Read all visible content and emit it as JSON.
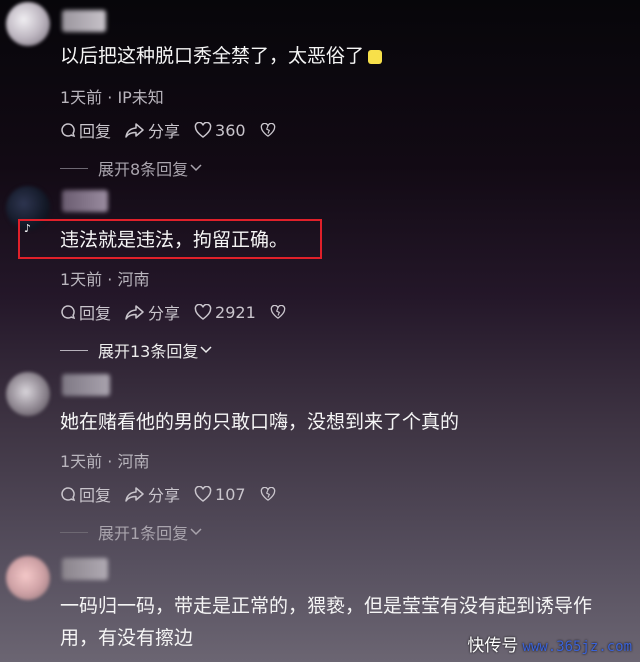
{
  "comments": [
    {
      "text": "以后把这种脱口秀全禁了，太恶俗了",
      "meta": "1天前 · IP未知",
      "reply_label": "回复",
      "share_label": "分享",
      "likes": "360",
      "expand_label": "展开8条回复"
    },
    {
      "text": "违法就是违法，拘留正确。",
      "meta": "1天前 · 河南",
      "reply_label": "回复",
      "share_label": "分享",
      "likes": "2921",
      "expand_label": "展开13条回复"
    },
    {
      "text": "她在赌看他的男的只敢口嗨，没想到来了个真的",
      "meta": "1天前 · 河南",
      "reply_label": "回复",
      "share_label": "分享",
      "likes": "107",
      "expand_label": "展开1条回复"
    },
    {
      "text_line1": "一码归一码，带走是正常的，猥亵，但是莹莹有没有起到诱导作",
      "text_line2": "用，有没有擦边"
    }
  ],
  "watermark": {
    "prefix": "快传号",
    "url": "www.365jz.com"
  },
  "colors": {
    "highlight_border": "#e0202a",
    "text": "#f5f5f5",
    "meta": "#b9b5bd"
  },
  "icons": [
    "comment-icon",
    "share-icon",
    "heart-icon",
    "broken-heart-icon",
    "chevron-down-icon"
  ]
}
